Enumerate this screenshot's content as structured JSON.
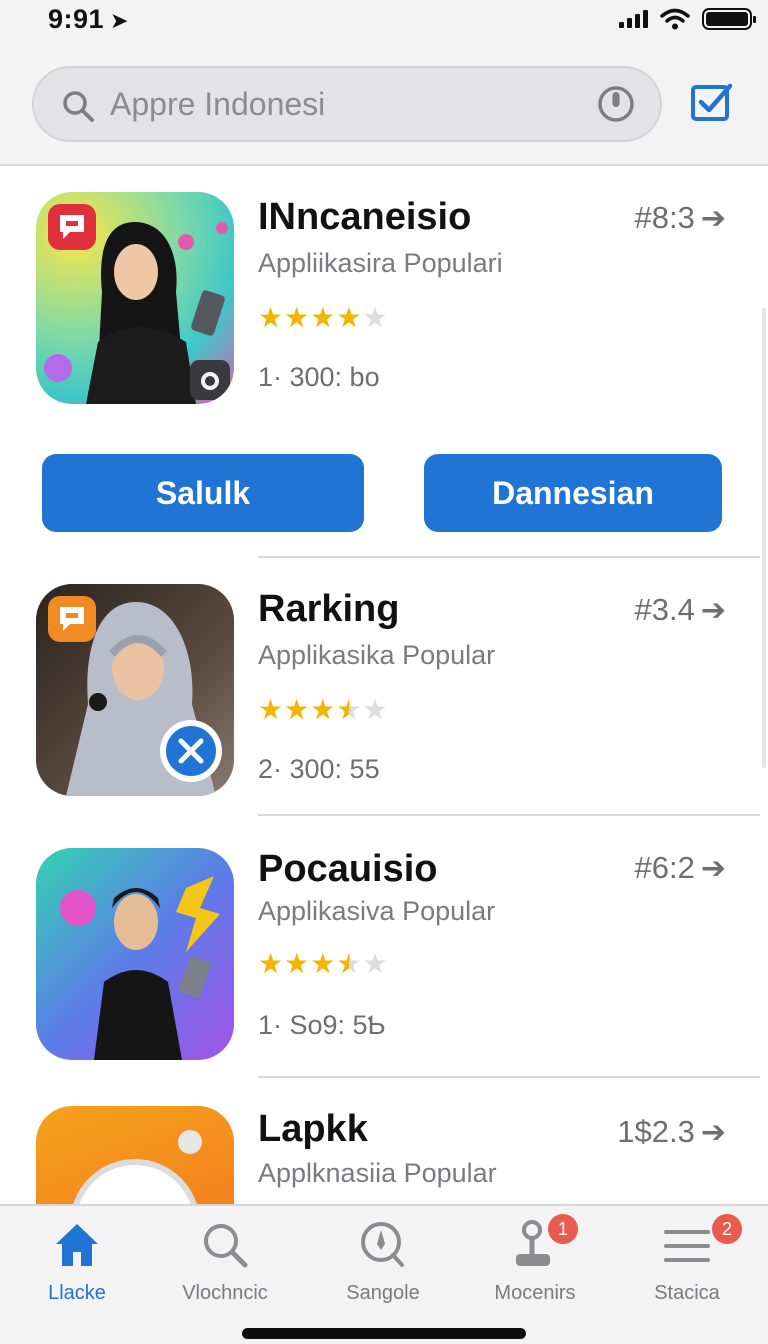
{
  "status_bar": {
    "time": "9:91",
    "location_glyph": "➤"
  },
  "search": {
    "placeholder": "Appre Indonesi"
  },
  "apps": [
    {
      "name": "INncaneisio",
      "subtitle": "Appliikasira Populari",
      "rank": "#8:3",
      "rating": 4,
      "meta": "1· 300: bo",
      "icon_badge": "chat-icon",
      "icon_overlay": "camera-icon",
      "colors": [
        "#f8e74a",
        "#3fc7c7",
        "#e05bb0"
      ]
    },
    {
      "name": "Rarking",
      "subtitle": "Applikasika Popular",
      "rank": "#3.4",
      "rating": 3.5,
      "meta": "2· 300: 55",
      "icon_badge": "chat-icon",
      "icon_overlay": "close-icon",
      "colors": [
        "#2a2420",
        "#5c4a3e",
        "#8a7a70"
      ]
    },
    {
      "name": "Pocauisio",
      "subtitle": "Applikasiva Popular",
      "rank": "#6:2",
      "rating": 3.5,
      "meta": "1· So9: 5Ƅ",
      "icon_badge": "",
      "icon_overlay": "",
      "colors": [
        "#34d3b2",
        "#5b7de8",
        "#a154e6"
      ]
    },
    {
      "name": "Lapkk",
      "subtitle": "Applknasiia Popular",
      "rank": "1$2.3",
      "rating": 0,
      "meta": "",
      "icon_badge": "",
      "icon_overlay": "",
      "colors": [
        "#f39a1a",
        "#f26b1e",
        "#ffffff"
      ]
    }
  ],
  "actions": {
    "primary": "Salulk",
    "secondary": "Dannesian"
  },
  "tabs": [
    {
      "label": "Llacke",
      "icon": "home-icon",
      "active": true,
      "badge": ""
    },
    {
      "label": "Vlochncic",
      "icon": "search-icon",
      "active": false,
      "badge": ""
    },
    {
      "label": "Sangole",
      "icon": "compass-icon",
      "active": false,
      "badge": ""
    },
    {
      "label": "Mocenirs",
      "icon": "joystick-icon",
      "active": false,
      "badge": "1"
    },
    {
      "label": "Stacica",
      "icon": "menu-icon",
      "active": false,
      "badge": "2"
    }
  ],
  "colors": {
    "accent": "#1f74d4",
    "star": "#f4b400",
    "badge": "#e95a4f"
  }
}
